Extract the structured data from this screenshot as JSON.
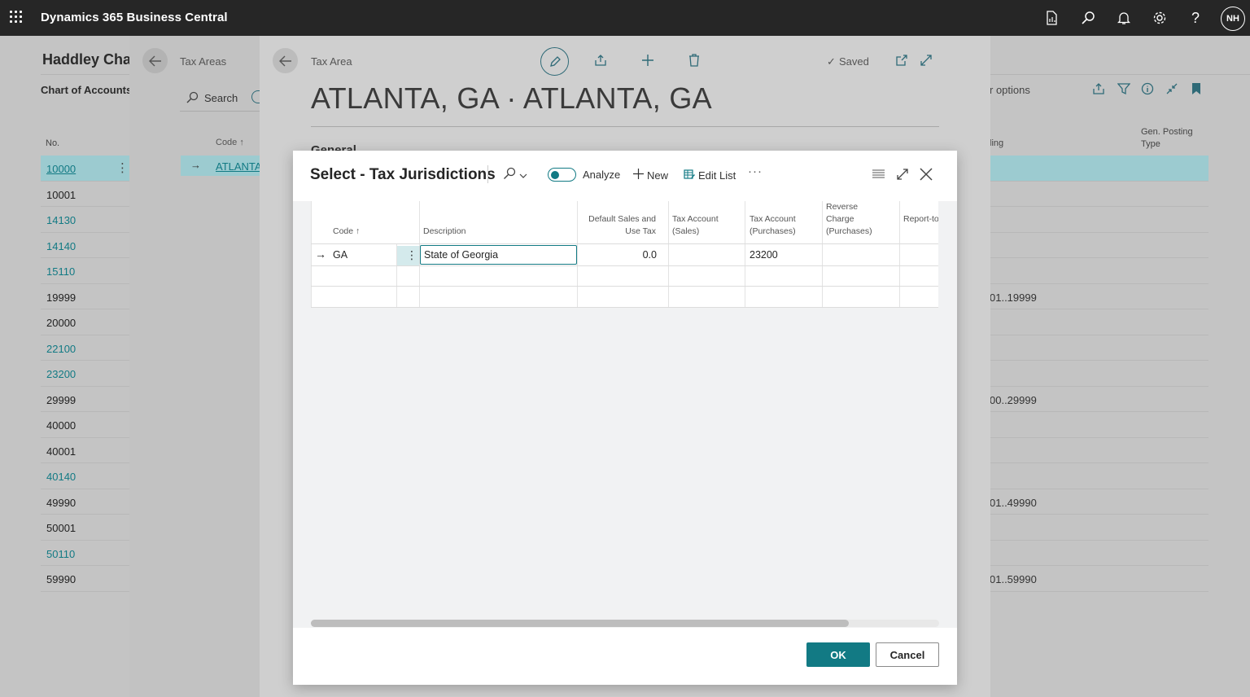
{
  "topbar": {
    "app_name": "Dynamics 365 Business Central",
    "user_initials": "NH"
  },
  "chart_of_accounts": {
    "company_title": "Haddley Cha",
    "tab_label": "Chart of Accounts:",
    "options_label": "r options",
    "col_no": "No.",
    "col_totaling": "ling",
    "col_gen_posting": "Gen. Posting Type",
    "rows": [
      {
        "no": "10000",
        "link": true,
        "totaling": ""
      },
      {
        "no": "10001",
        "link": false,
        "totaling": ""
      },
      {
        "no": "14130",
        "link": true,
        "totaling": ""
      },
      {
        "no": "14140",
        "link": true,
        "totaling": ""
      },
      {
        "no": "15110",
        "link": true,
        "totaling": ""
      },
      {
        "no": "19999",
        "link": false,
        "totaling": "01..19999"
      },
      {
        "no": "20000",
        "link": false,
        "totaling": ""
      },
      {
        "no": "22100",
        "link": true,
        "totaling": ""
      },
      {
        "no": "23200",
        "link": true,
        "totaling": ""
      },
      {
        "no": "29999",
        "link": false,
        "totaling": "00..29999"
      },
      {
        "no": "40000",
        "link": false,
        "totaling": ""
      },
      {
        "no": "40001",
        "link": false,
        "totaling": ""
      },
      {
        "no": "40140",
        "link": true,
        "totaling": ""
      },
      {
        "no": "49990",
        "link": false,
        "totaling": "01..49990"
      },
      {
        "no": "50001",
        "link": false,
        "totaling": ""
      },
      {
        "no": "50110",
        "link": true,
        "totaling": ""
      },
      {
        "no": "59990",
        "link": false,
        "totaling": "01..59990"
      }
    ]
  },
  "tax_areas": {
    "title": "Tax Areas",
    "search_label": "Search",
    "col_code": "Code ↑",
    "row_value": "ATLANTA"
  },
  "tax_area_card": {
    "breadcrumb": "Tax Area",
    "saved_label": "Saved",
    "heading": "ATLANTA, GA · ATLANTA, GA",
    "section_general": "General"
  },
  "dialog": {
    "title": "Select - Tax Jurisdictions",
    "analyze_label": "Analyze",
    "new_label": "New",
    "edit_list_label": "Edit List",
    "more_label": "···",
    "columns": {
      "code": "Code ↑",
      "description": "Description",
      "default_sales": "Default Sales and Use Tax",
      "tax_account_sales": "Tax Account (Sales)",
      "tax_account_purchases": "Tax Account (Purchases)",
      "reverse_charge": "Reverse Charge (Purchases)",
      "report_to": "Report-to Jurisdiction"
    },
    "row": {
      "code": "GA",
      "description": "State of Georgia",
      "default_sales": "0.0",
      "tax_account_sales": "",
      "tax_account_purchases": "23200",
      "reverse_charge": "",
      "report_to": ""
    },
    "ok_label": "OK",
    "cancel_label": "Cancel"
  }
}
